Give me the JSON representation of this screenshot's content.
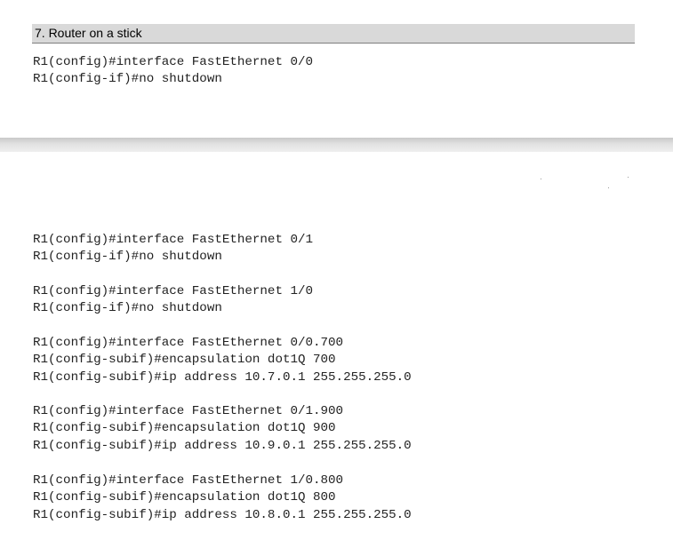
{
  "section_title": "7. Router on a stick",
  "blocks": [
    [
      "R1(config)#interface FastEthernet 0/0",
      "R1(config-if)#no shutdown"
    ],
    [
      "R1(config)#interface FastEthernet 0/1",
      "R1(config-if)#no shutdown"
    ],
    [
      "R1(config)#interface FastEthernet 1/0",
      "R1(config-if)#no shutdown"
    ],
    [
      "R1(config)#interface FastEthernet 0/0.700",
      "R1(config-subif)#encapsulation dot1Q 700",
      "R1(config-subif)#ip address 10.7.0.1 255.255.255.0"
    ],
    [
      "R1(config)#interface FastEthernet 0/1.900",
      "R1(config-subif)#encapsulation dot1Q 900",
      "R1(config-subif)#ip address 10.9.0.1 255.255.255.0"
    ],
    [
      "R1(config)#interface FastEthernet 1/0.800",
      "R1(config-subif)#encapsulation dot1Q 800",
      "R1(config-subif)#ip address 10.8.0.1 255.255.255.0"
    ]
  ]
}
